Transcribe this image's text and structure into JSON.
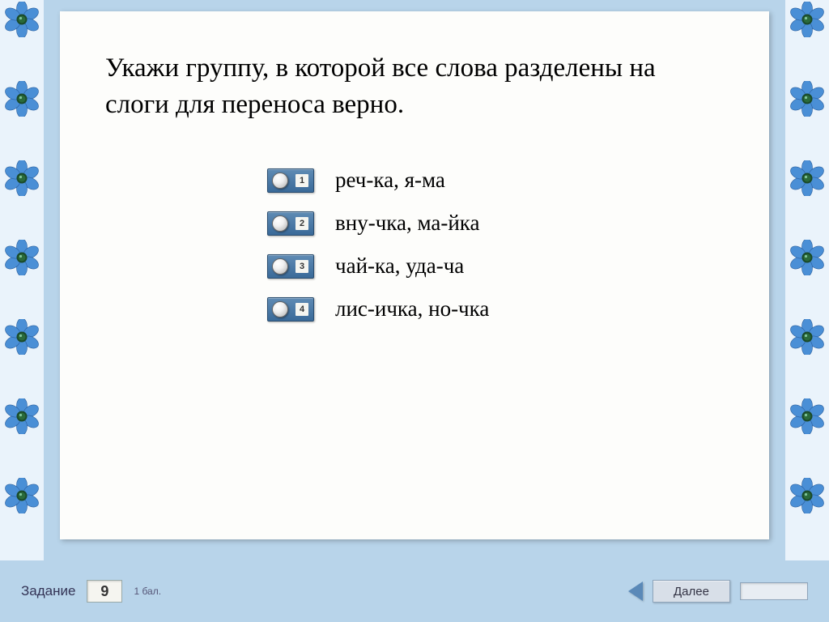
{
  "question": "Укажи группу, в которой все слова разделены на слоги для переноса верно.",
  "options": [
    {
      "num": "1",
      "text": "реч-ка, я-ма"
    },
    {
      "num": "2",
      "text": "вну-чка, ма-йка"
    },
    {
      "num": "3",
      "text": "чай-ка, уда-ча"
    },
    {
      "num": "4",
      "text": "лис-ичка, но-чка"
    }
  ],
  "footer": {
    "task_label": "Задание",
    "task_number": "9",
    "points": "1 бал.",
    "next_label": "Далее"
  }
}
